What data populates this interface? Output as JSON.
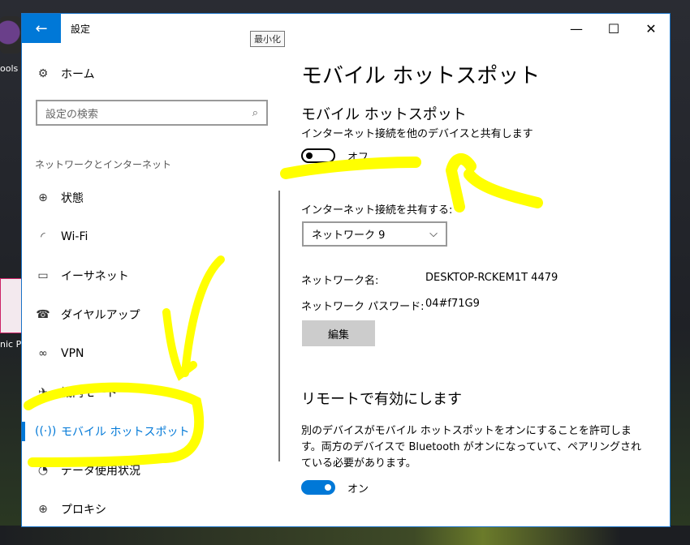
{
  "desktop": {
    "icon1_label": "ools",
    "icon2_label": "nic Pi"
  },
  "window": {
    "title": "設定",
    "back_glyph": "←",
    "tooltip": "最小化",
    "controls": {
      "minimize": "—",
      "maximize": "☐",
      "close": "✕"
    }
  },
  "sidebar": {
    "home_label": "ホーム",
    "search_placeholder": "設定の検索",
    "section_label": "ネットワークとインターネット",
    "items": [
      {
        "label": "状態",
        "icon": "globe-icon"
      },
      {
        "label": "Wi-Fi",
        "icon": "wifi-icon"
      },
      {
        "label": "イーサネット",
        "icon": "ethernet-icon"
      },
      {
        "label": "ダイヤルアップ",
        "icon": "dialup-icon"
      },
      {
        "label": "VPN",
        "icon": "vpn-icon"
      },
      {
        "label": "機内モード",
        "icon": "airplane-icon"
      },
      {
        "label": "モバイル ホットスポット",
        "icon": "hotspot-icon"
      },
      {
        "label": "データ使用状況",
        "icon": "data-usage-icon"
      },
      {
        "label": "プロキシ",
        "icon": "proxy-globe-icon"
      }
    ]
  },
  "main": {
    "page_title": "モバイル ホットスポット",
    "hotspot": {
      "title": "モバイル ホットスポット",
      "description": "インターネット接続を他のデバイスと共有します",
      "toggle_label": "オフ"
    },
    "share": {
      "label": "インターネット接続を共有する:",
      "selected": "ネットワーク  9"
    },
    "network_name_key": "ネットワーク名:",
    "network_name_value": "DESKTOP-RCKEM1T 4479",
    "password_key": "ネットワーク パスワード:",
    "password_value": "04#f71G9",
    "edit_label": "編集",
    "remote": {
      "title": "リモートで有効にします",
      "description": "別のデバイスがモバイル ホットスポットをオンにすることを許可します。両方のデバイスで Bluetooth がオンになっていて、ペアリングされている必要があります。",
      "toggle_label": "オン"
    }
  },
  "colors": {
    "accent": "#0078d7",
    "annotation": "#ffff00"
  }
}
